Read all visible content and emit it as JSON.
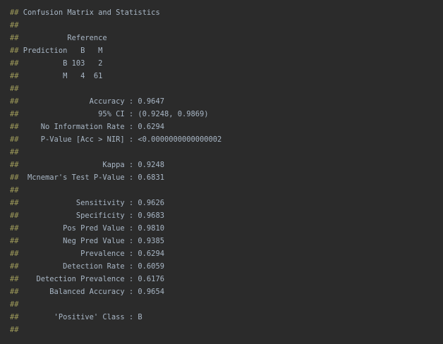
{
  "console": {
    "prefix": "##",
    "lines": [
      " Confusion Matrix and Statistics",
      "",
      "           Reference",
      " Prediction   B   M",
      "          B 103   2",
      "          M   4  61",
      "",
      "                Accuracy : 0.9647",
      "                  95% CI : (0.9248, 0.9869)",
      "     No Information Rate : 0.6294",
      "     P-Value [Acc > NIR] : <0.0000000000000002",
      "",
      "                   Kappa : 0.9248",
      "  Mcnemar's Test P-Value : 0.6831",
      "",
      "             Sensitivity : 0.9626",
      "             Specificity : 0.9683",
      "          Pos Pred Value : 0.9810",
      "          Neg Pred Value : 0.9385",
      "              Prevalence : 0.6294",
      "          Detection Rate : 0.6059",
      "    Detection Prevalence : 0.6176",
      "       Balanced Accuracy : 0.9654",
      "",
      "        'Positive' Class : B",
      ""
    ]
  }
}
